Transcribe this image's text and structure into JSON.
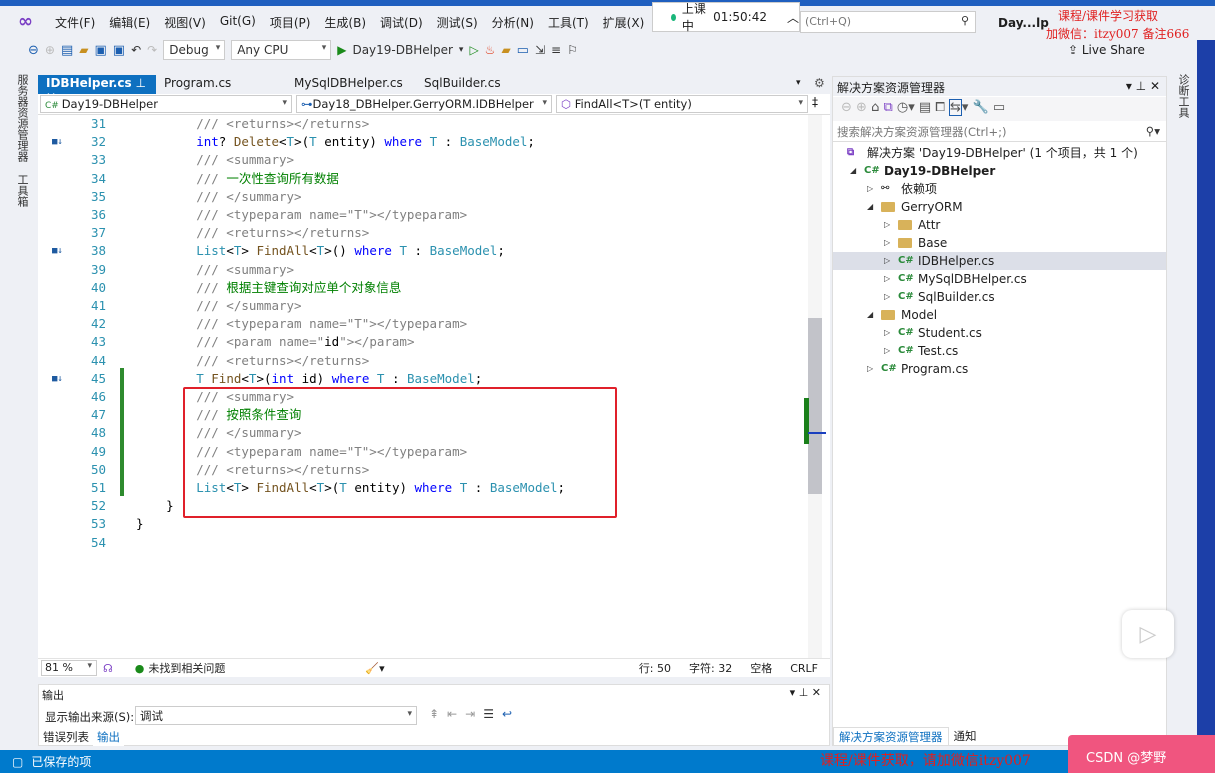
{
  "menu": {
    "items": [
      "文件(F)",
      "编辑(E)",
      "视图(V)",
      "Git(G)",
      "项目(P)",
      "生成(B)",
      "调试(D)",
      "测试(S)",
      "分析(N)",
      "工具(T)",
      "扩展(X)"
    ]
  },
  "timer": {
    "label": "上课中",
    "time": "01:50:42"
  },
  "search": {
    "placeholder": "(Ctrl+Q)"
  },
  "project_title": "Day...lp",
  "watermark": {
    "top1": "课程/课件学习获取",
    "top2": "加微信：itzy007  备注666",
    "bottom": "课程/课件获取，请加微信itzy007",
    "csdn": "CSDN @梦野"
  },
  "toolbar": {
    "config": "Debug",
    "platform": "Any CPU",
    "startup": "Day19-DBHelper",
    "live_share": "Live Share"
  },
  "left_strip": {
    "server_explorer": "服务器资源管理器",
    "toolbox": "工具箱"
  },
  "right_strip": {
    "diagnostics": "诊断工具"
  },
  "tabs": [
    {
      "label": "IDBHelper.cs",
      "active": true
    },
    {
      "label": "Program.cs"
    },
    {
      "label": "MySqlDBHelper.cs"
    },
    {
      "label": "SqlBuilder.cs"
    }
  ],
  "navbar": {
    "project": "Day19-DBHelper",
    "type": "Day18_DBHelper.GerryORM.IDBHelper",
    "member": "FindAll<T>(T entity)"
  },
  "code": [
    {
      "n": 31,
      "t": [
        [
          "cm",
          "        /// <returns></returns>"
        ]
      ]
    },
    {
      "n": 32,
      "m": true,
      "t": [
        [
          "pl",
          "        "
        ],
        [
          "kw",
          "int"
        ],
        [
          "pl",
          "? "
        ],
        [
          "fn",
          "Delete"
        ],
        [
          "pl",
          "<"
        ],
        [
          "ty",
          "T"
        ],
        [
          "pl",
          ">("
        ],
        [
          "ty",
          "T"
        ],
        [
          "pl",
          " entity) "
        ],
        [
          "kw",
          "where"
        ],
        [
          "pl",
          " "
        ],
        [
          "ty",
          "T"
        ],
        [
          "pl",
          " : "
        ],
        [
          "ty",
          "BaseModel"
        ],
        [
          "pl",
          ";"
        ]
      ]
    },
    {
      "n": 33,
      "t": [
        [
          "cm",
          "        /// <summary>"
        ]
      ]
    },
    {
      "n": 34,
      "t": [
        [
          "cm",
          "        /// "
        ],
        [
          "gr",
          "一次性查询所有数据"
        ]
      ]
    },
    {
      "n": 35,
      "t": [
        [
          "cm",
          "        /// </summary>"
        ]
      ]
    },
    {
      "n": 36,
      "t": [
        [
          "cm",
          "        /// <typeparam name=\"T\"></typeparam>"
        ]
      ]
    },
    {
      "n": 37,
      "t": [
        [
          "cm",
          "        /// <returns></returns>"
        ]
      ]
    },
    {
      "n": 38,
      "m": true,
      "t": [
        [
          "pl",
          "        "
        ],
        [
          "ty",
          "List"
        ],
        [
          "pl",
          "<"
        ],
        [
          "ty",
          "T"
        ],
        [
          "pl",
          "> "
        ],
        [
          "fn",
          "FindAll"
        ],
        [
          "pl",
          "<"
        ],
        [
          "ty",
          "T"
        ],
        [
          "pl",
          ">() "
        ],
        [
          "kw",
          "where"
        ],
        [
          "pl",
          " "
        ],
        [
          "ty",
          "T"
        ],
        [
          "pl",
          " : "
        ],
        [
          "ty",
          "BaseModel"
        ],
        [
          "pl",
          ";"
        ]
      ]
    },
    {
      "n": 39,
      "t": [
        [
          "cm",
          "        /// <summary>"
        ]
      ]
    },
    {
      "n": 40,
      "t": [
        [
          "cm",
          "        /// "
        ],
        [
          "gr",
          "根据主键查询对应单个对象信息"
        ]
      ]
    },
    {
      "n": 41,
      "t": [
        [
          "cm",
          "        /// </summary>"
        ]
      ]
    },
    {
      "n": 42,
      "t": [
        [
          "cm",
          "        /// <typeparam name=\"T\"></typeparam>"
        ]
      ]
    },
    {
      "n": 43,
      "t": [
        [
          "cm",
          "        /// <param name=\""
        ],
        [
          "pl",
          "id"
        ],
        [
          "cm",
          "\"></param>"
        ]
      ]
    },
    {
      "n": 44,
      "t": [
        [
          "cm",
          "        /// <returns></returns>"
        ]
      ]
    },
    {
      "n": 45,
      "m": true,
      "t": [
        [
          "pl",
          "        "
        ],
        [
          "ty",
          "T"
        ],
        [
          "pl",
          " "
        ],
        [
          "fn",
          "Find"
        ],
        [
          "pl",
          "<"
        ],
        [
          "ty",
          "T"
        ],
        [
          "pl",
          ">("
        ],
        [
          "kw",
          "int"
        ],
        [
          "pl",
          " id) "
        ],
        [
          "kw",
          "where"
        ],
        [
          "pl",
          " "
        ],
        [
          "ty",
          "T"
        ],
        [
          "pl",
          " : "
        ],
        [
          "ty",
          "BaseModel"
        ],
        [
          "pl",
          ";"
        ]
      ]
    },
    {
      "n": 46,
      "t": [
        [
          "cm",
          "        /// <summary>"
        ]
      ]
    },
    {
      "n": 47,
      "t": [
        [
          "cm",
          "        /// "
        ],
        [
          "gr",
          "按照条件查询"
        ]
      ]
    },
    {
      "n": 48,
      "t": [
        [
          "cm",
          "        /// </summary>"
        ]
      ]
    },
    {
      "n": 49,
      "t": [
        [
          "cm",
          "        /// <typeparam name=\"T\"></typeparam>"
        ]
      ]
    },
    {
      "n": 50,
      "t": [
        [
          "cm",
          "        /// <returns></returns>"
        ]
      ]
    },
    {
      "n": 51,
      "t": [
        [
          "pl",
          "        "
        ],
        [
          "ty",
          "List"
        ],
        [
          "pl",
          "<"
        ],
        [
          "ty",
          "T"
        ],
        [
          "pl",
          "> "
        ],
        [
          "fn",
          "FindAll"
        ],
        [
          "pl",
          "<"
        ],
        [
          "ty",
          "T"
        ],
        [
          "pl",
          ">("
        ],
        [
          "ty",
          "T"
        ],
        [
          "pl",
          " entity) "
        ],
        [
          "kw",
          "where"
        ],
        [
          "pl",
          " "
        ],
        [
          "ty",
          "T"
        ],
        [
          "pl",
          " : "
        ],
        [
          "ty",
          "BaseModel"
        ],
        [
          "pl",
          ";"
        ]
      ]
    },
    {
      "n": 52,
      "t": [
        [
          "pl",
          "    }"
        ]
      ]
    },
    {
      "n": 53,
      "t": [
        [
          "pl",
          "}"
        ]
      ]
    },
    {
      "n": 54,
      "t": []
    }
  ],
  "editor_status": {
    "zoom": "81 %",
    "issues": "未找到相关问题",
    "line": "行: 50",
    "col": "字符: 32",
    "indent": "空格",
    "eol": "CRLF"
  },
  "output": {
    "title": "输出",
    "source_label": "显示输出来源(S):",
    "source_value": "调试",
    "tabs": [
      "错误列表",
      "输出"
    ]
  },
  "statusbar": {
    "text": "已保存的项"
  },
  "solution": {
    "title": "解决方案资源管理器",
    "search_placeholder": "搜索解决方案资源管理器(Ctrl+;)",
    "tree": [
      {
        "label": "解决方案 'Day19-DBHelper' (1 个项目，共 1 个)",
        "lvl": 0,
        "icon": "solution",
        "exp": ""
      },
      {
        "label": "Day19-DBHelper",
        "lvl": 1,
        "icon": "project",
        "exp": "open",
        "bold": true
      },
      {
        "label": "依赖项",
        "lvl": 2,
        "icon": "deps",
        "exp": "closed"
      },
      {
        "label": "GerryORM",
        "lvl": 2,
        "icon": "folder",
        "exp": "open"
      },
      {
        "label": "Attr",
        "lvl": 3,
        "icon": "folder",
        "exp": "closed"
      },
      {
        "label": "Base",
        "lvl": 3,
        "icon": "folder",
        "exp": "closed"
      },
      {
        "label": "IDBHelper.cs",
        "lvl": 3,
        "icon": "cs",
        "exp": "closed",
        "selected": true
      },
      {
        "label": "MySqlDBHelper.cs",
        "lvl": 3,
        "icon": "cs",
        "exp": "closed"
      },
      {
        "label": "SqlBuilder.cs",
        "lvl": 3,
        "icon": "cs",
        "exp": "closed"
      },
      {
        "label": "Model",
        "lvl": 2,
        "icon": "folder",
        "exp": "open"
      },
      {
        "label": "Student.cs",
        "lvl": 3,
        "icon": "cs",
        "exp": "closed"
      },
      {
        "label": "Test.cs",
        "lvl": 3,
        "icon": "cs",
        "exp": "closed"
      },
      {
        "label": "Program.cs",
        "lvl": 2,
        "icon": "cs",
        "exp": "closed"
      }
    ],
    "bottom_tabs": [
      "解决方案资源管理器",
      "通知"
    ]
  }
}
